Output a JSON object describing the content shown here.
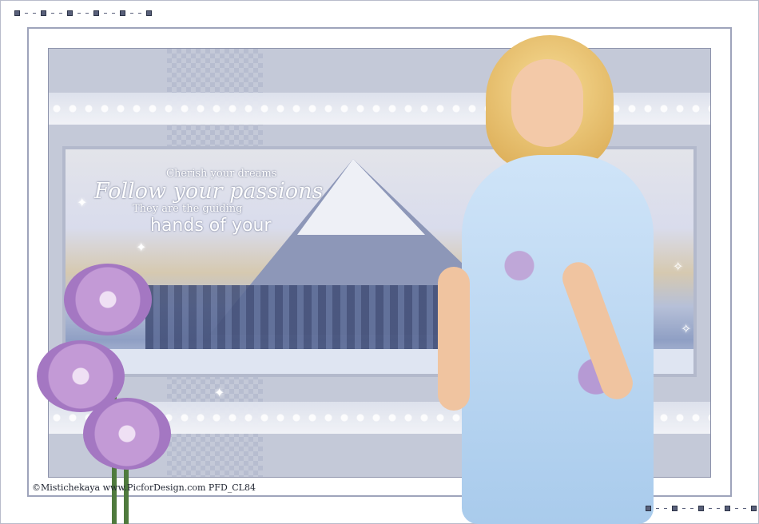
{
  "artwork": {
    "quote": {
      "line1": "Cherish your dreams",
      "line2": "Follow your passions",
      "line3": "They are the guiding",
      "line4": "hands of your"
    },
    "credit": "©Mistichekaya www.PicforDesign.com PFD_CL84"
  },
  "colors": {
    "frame": "#9ea4bb",
    "inner_background": "#c4c9d8",
    "dress": "#a9cbec",
    "flower": "#c39ad6",
    "hair": "#d9a850"
  }
}
